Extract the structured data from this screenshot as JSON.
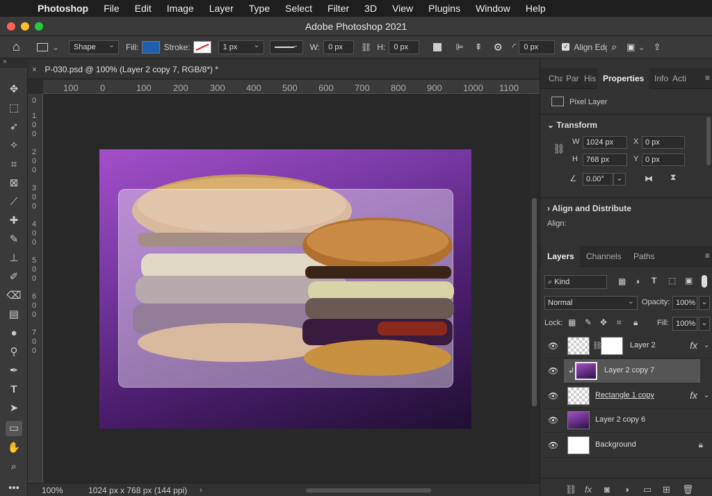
{
  "menubar": {
    "app": "Photoshop",
    "items": [
      "File",
      "Edit",
      "Image",
      "Layer",
      "Type",
      "Select",
      "Filter",
      "3D",
      "View",
      "Plugins",
      "Window",
      "Help"
    ]
  },
  "window": {
    "title": "Adobe Photoshop 2021"
  },
  "options": {
    "mode": "Shape",
    "fill_label": "Fill:",
    "stroke_label": "Stroke:",
    "stroke_width": "1 px",
    "w_label": "W:",
    "w_value": "0 px",
    "h_label": "H:",
    "h_value": "0 px",
    "radius": "0 px",
    "align_edges": "Align Edges",
    "fill_color": "#1f5fad"
  },
  "document": {
    "tab_title": "P-030.psd @ 100% (Layer 2 copy 7, RGB/8*) *",
    "hruler": [
      "100",
      "0",
      "100",
      "200",
      "300",
      "400",
      "500",
      "600",
      "700",
      "800",
      "900",
      "1000",
      "1100"
    ],
    "vruler": [
      "0",
      "100",
      "200",
      "300",
      "400",
      "500",
      "600",
      "700"
    ],
    "canvas_colors": {
      "top_left": "#a44fc9",
      "bottom_right": "#1f0f32"
    }
  },
  "status": {
    "zoom": "100%",
    "info": "1024 px x 768 px (144 ppi)"
  },
  "properties": {
    "tabs": [
      "Cha",
      "Par",
      "His",
      "Properties",
      "Info",
      "Acti"
    ],
    "kind": "Pixel Layer",
    "transform": "Transform",
    "w_label": "W",
    "w": "1024 px",
    "x_label": "X",
    "x": "0 px",
    "h_label": "H",
    "h": "768 px",
    "y_label": "Y",
    "y": "0 px",
    "angle": "0.00°",
    "align_title": "Align and Distribute",
    "align_label": "Align:"
  },
  "layers_panel": {
    "tabs": [
      "Layers",
      "Channels",
      "Paths"
    ],
    "filter": "Kind",
    "blend": "Normal",
    "opacity_label": "Opacity:",
    "opacity": "100%",
    "lock_label": "Lock:",
    "fill_label": "Fill:",
    "fill": "100%",
    "layers": [
      {
        "name": "Layer 2",
        "fx": "fx"
      },
      {
        "name": "Layer 2 copy 7"
      },
      {
        "name": "Rectangle 1 copy",
        "fx": "fx"
      },
      {
        "name": "Layer 2 copy 6"
      },
      {
        "name": "Background"
      }
    ]
  }
}
